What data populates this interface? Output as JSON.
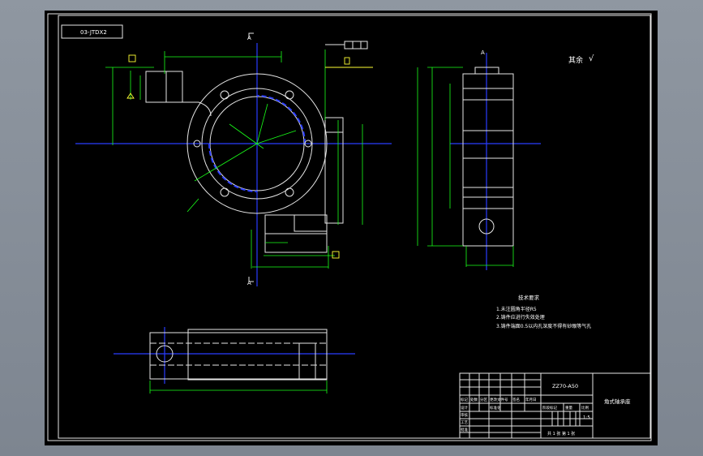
{
  "drawing": {
    "code_label": "03-JTDX2",
    "section_mark": "A",
    "roughness_text": "其余",
    "roughness_symbol": "√",
    "tech_req": {
      "title": "技术要求",
      "items": [
        "1.未注圆角半径R5",
        "2.铸件应进行失效处理",
        "3.铸件端面0.5以内孔深度不得有砂眼等气孔"
      ]
    },
    "title_block": {
      "model": "ZZ70-A50",
      "part_name": "角式轴承座",
      "scale": "1:5",
      "sheet_info": "共 1 张 第 1 张",
      "header_cells": [
        "标记",
        "处数",
        "分区",
        "更改文件号",
        "签名",
        "年月日"
      ],
      "role_cells": [
        "设计",
        "审核",
        "工艺",
        "批准"
      ],
      "std_label": "标准化",
      "stage_labels": [
        "阶段标记",
        "重量",
        "比例"
      ]
    },
    "colors": {
      "background": "#000000",
      "frame": "#e6e6e6",
      "dimension": "#19ff19",
      "centerline": "#2a3cff",
      "annotation": "#ffff33"
    }
  }
}
